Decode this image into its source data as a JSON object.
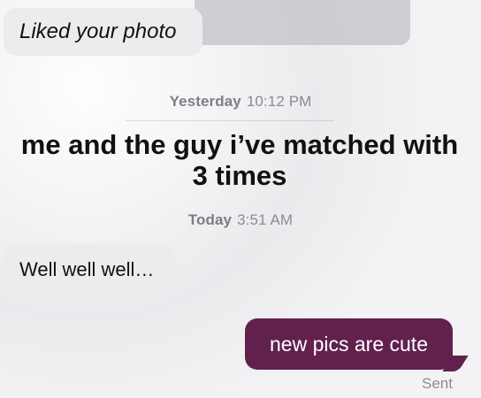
{
  "messages": {
    "liked_photo": "Liked your photo",
    "yesterday_label": "Yesterday",
    "yesterday_time": "10:12 PM",
    "caption": "me and the guy i’ve matched with 3 times",
    "today_label": "Today",
    "today_time": "3:51 AM",
    "received_text": "Well well well…",
    "sent_text": "new pics are cute",
    "sent_status": "Sent"
  },
  "colors": {
    "sent_bubble": "#62204f",
    "received_bubble": "#ececee",
    "timestamp_text": "#8d8b91"
  }
}
